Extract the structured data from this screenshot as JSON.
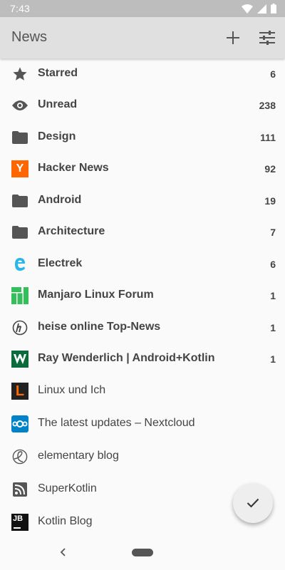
{
  "status": {
    "time": "7:43"
  },
  "appbar": {
    "title": "News"
  },
  "feeds": [
    {
      "label": "Starred",
      "count": "6",
      "bold": true,
      "icon": "star-icon"
    },
    {
      "label": "Unread",
      "count": "238",
      "bold": true,
      "icon": "eye-icon"
    },
    {
      "label": "Design",
      "count": "111",
      "bold": true,
      "icon": "folder-icon"
    },
    {
      "label": "Hacker News",
      "count": "92",
      "bold": true,
      "icon": "hacker-news-icon",
      "icon_text": "Y"
    },
    {
      "label": "Android",
      "count": "19",
      "bold": true,
      "icon": "folder-icon"
    },
    {
      "label": "Architecture",
      "count": "7",
      "bold": true,
      "icon": "folder-icon"
    },
    {
      "label": "Electrek",
      "count": "6",
      "bold": true,
      "icon": "electrek-icon"
    },
    {
      "label": "Manjaro Linux Forum",
      "count": "1",
      "bold": true,
      "icon": "manjaro-icon"
    },
    {
      "label": "heise online Top-News",
      "count": "1",
      "bold": true,
      "icon": "heise-icon"
    },
    {
      "label": "Ray Wenderlich | Android+Kotlin",
      "count": "1",
      "bold": true,
      "icon": "raywenderlich-icon"
    },
    {
      "label": "Linux und Ich",
      "count": "",
      "bold": false,
      "icon": "linux-und-ich-icon",
      "icon_text": "L"
    },
    {
      "label": "The latest updates – Nextcloud",
      "count": "",
      "bold": false,
      "icon": "nextcloud-icon"
    },
    {
      "label": "elementary blog",
      "count": "",
      "bold": false,
      "icon": "elementary-icon"
    },
    {
      "label": "SuperKotlin",
      "count": "",
      "bold": false,
      "icon": "rss-icon"
    },
    {
      "label": "Kotlin Blog",
      "count": "",
      "bold": false,
      "icon": "jetbrains-icon",
      "icon_text": "JB"
    }
  ],
  "colors": {
    "statusbar": "#bdbdbd",
    "appbar": "#e0e0e0",
    "hacker_news": "#ff6600",
    "linux_und_ich": "#ff6a00",
    "electrek": "#29b6e8",
    "manjaro": "#35bf5c",
    "raywenderlich": "#0b6b3a",
    "nextcloud": "#0082c9"
  }
}
